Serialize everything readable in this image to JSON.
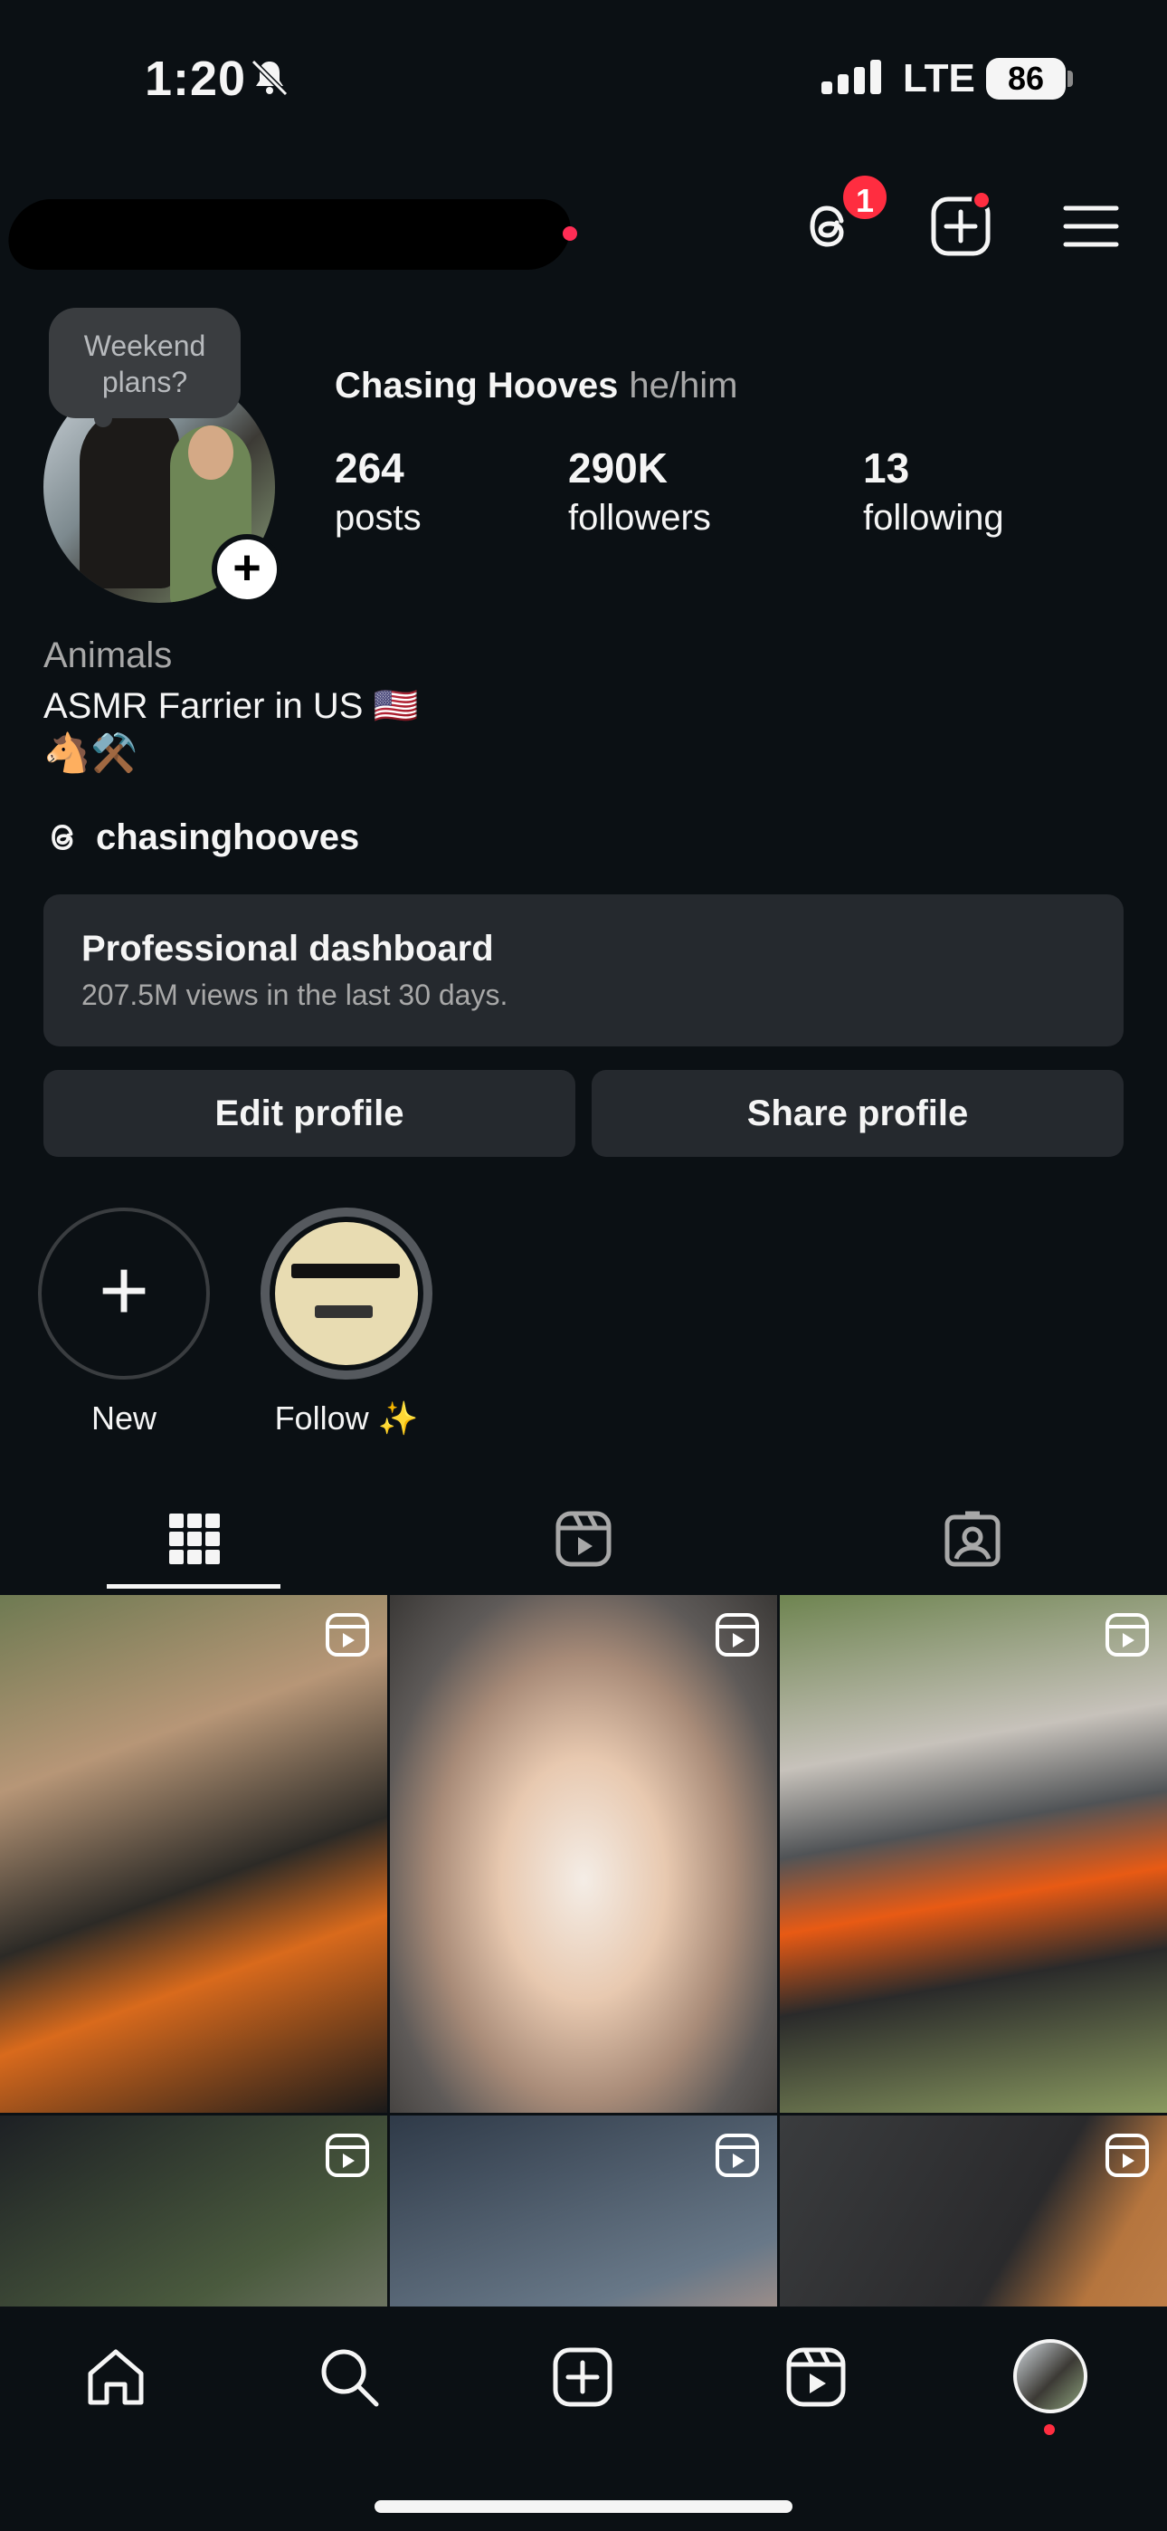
{
  "status_bar": {
    "time": "1:20",
    "network": "LTE",
    "battery": "86"
  },
  "header": {
    "threads_badge_count": "1"
  },
  "profile": {
    "note": "Weekend plans?",
    "display_name": "Chasing Hooves",
    "pronouns": "he/him",
    "stats": [
      {
        "value": "264",
        "label": "posts"
      },
      {
        "value": "290K",
        "label": "followers"
      },
      {
        "value": "13",
        "label": "following"
      }
    ],
    "category": "Animals",
    "bio_line1": "ASMR Farrier in US 🇺🇸",
    "bio_line2": "🐴⚒️",
    "threads_handle": "chasinghooves"
  },
  "dashboard": {
    "title": "Professional dashboard",
    "subtitle": "207.5M views in the last 30 days."
  },
  "actions": {
    "edit_label": "Edit profile",
    "share_label": "Share profile"
  },
  "highlights": [
    {
      "label": "New"
    },
    {
      "label": "Follow ✨"
    }
  ],
  "tabs": [
    "grid",
    "reels",
    "tagged"
  ],
  "colors": {
    "background": "#0b1014",
    "surface": "#25292e",
    "badge": "#ff2d40"
  }
}
